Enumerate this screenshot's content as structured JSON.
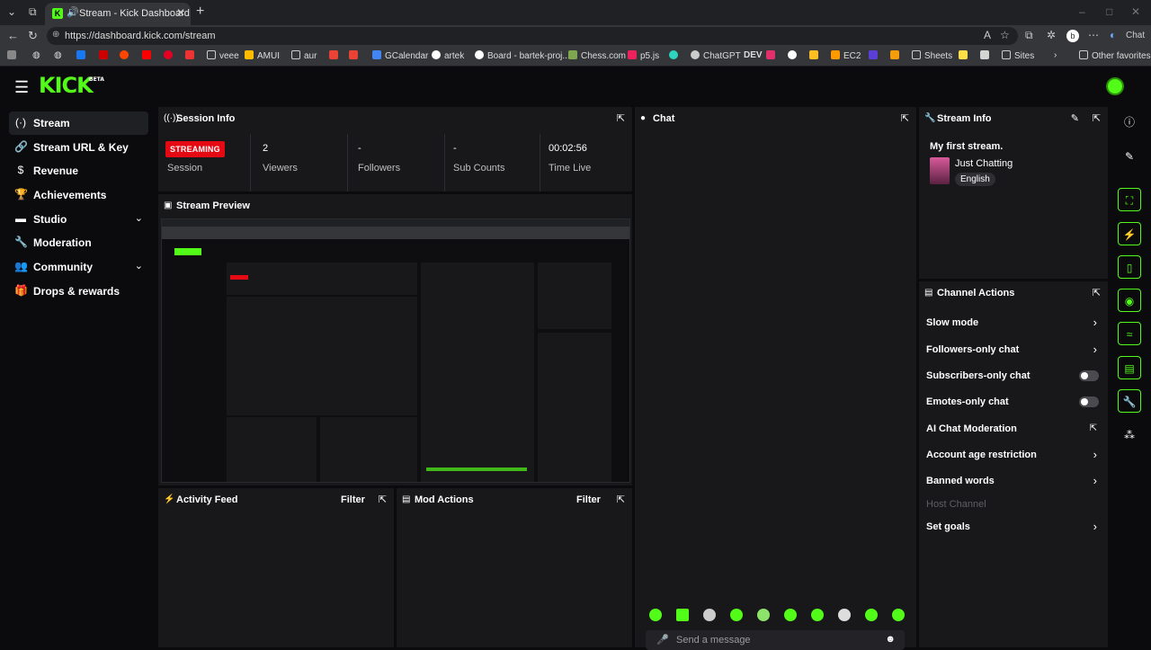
{
  "browser": {
    "tab_title": "Stream - Kick Dashboard",
    "url": "https://dashboard.kick.com/stream",
    "bookmarks": [
      "veee",
      "AMUI",
      "aur",
      "GCalendar",
      "artek",
      "Board - bartek-proj...",
      "Chess.com",
      "p5.js",
      "ChatGPT",
      "DEV",
      "EC2",
      "Sheets",
      "Sites",
      "Other favorites"
    ],
    "chat_label": "Chat"
  },
  "app": {
    "logo": "KICK",
    "logo_badge": "BETA"
  },
  "sidebar": {
    "items": [
      {
        "label": "Stream",
        "icon": "broadcast-icon"
      },
      {
        "label": "Stream URL & Key",
        "icon": "link-icon"
      },
      {
        "label": "Revenue",
        "icon": "dollar-icon"
      },
      {
        "label": "Achievements",
        "icon": "trophy-icon"
      },
      {
        "label": "Studio",
        "icon": "studio-icon"
      },
      {
        "label": "Moderation",
        "icon": "wrench-icon"
      },
      {
        "label": "Community",
        "icon": "people-icon"
      },
      {
        "label": "Drops & rewards",
        "icon": "gift-icon"
      }
    ]
  },
  "session": {
    "title": "Session Info",
    "status_badge": "STREAMING",
    "status_label": "Session",
    "viewers_value": "2",
    "viewers_label": "Viewers",
    "followers_value": "-",
    "followers_label": "Followers",
    "subs_value": "-",
    "subs_label": "Sub Counts",
    "time_value": "00:02:56",
    "time_label": "Time Live"
  },
  "preview": {
    "title": "Stream Preview"
  },
  "chat": {
    "title": "Chat",
    "placeholder": "Send a message"
  },
  "stream_info": {
    "title": "Stream Info",
    "stream_title": "My first stream.",
    "category": "Just Chatting",
    "language": "English"
  },
  "channel_actions": {
    "title": "Channel Actions",
    "items": [
      {
        "label": "Slow mode",
        "control": "arrow"
      },
      {
        "label": "Followers-only chat",
        "control": "arrow"
      },
      {
        "label": "Subscribers-only chat",
        "control": "toggle",
        "on": false
      },
      {
        "label": "Emotes-only chat",
        "control": "toggle",
        "on": false
      },
      {
        "label": "AI Chat Moderation",
        "control": "external"
      },
      {
        "label": "Account age restriction",
        "control": "arrow"
      },
      {
        "label": "Banned words",
        "control": "arrow"
      },
      {
        "label": "Host Channel",
        "control": "none",
        "disabled": true
      },
      {
        "label": "Set goals",
        "control": "arrow"
      }
    ]
  },
  "activity": {
    "title": "Activity Feed",
    "filter": "Filter"
  },
  "mod_actions": {
    "title": "Mod Actions",
    "filter": "Filter"
  },
  "colors": {
    "accent": "#53fc18",
    "live": "#e50914",
    "panel": "#18181b",
    "background": "#0b0b0d"
  }
}
